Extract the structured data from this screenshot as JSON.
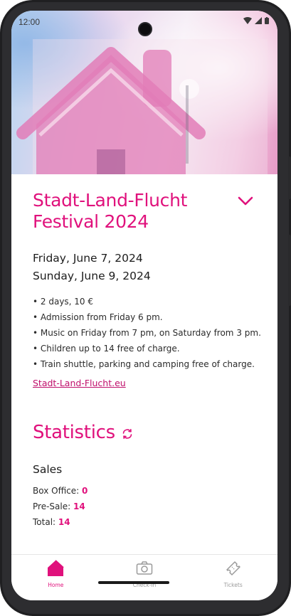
{
  "status_bar": {
    "time": "12:00"
  },
  "event": {
    "title": "Stadt-Land-Flucht Festival 2024",
    "date_start": "Friday, June 7, 2024",
    "date_end": "Sunday, June 9, 2024",
    "details": [
      "• 2 days, 10 €",
      "• Admission from Friday 6 pm.",
      "• Music on Friday from 7 pm, on Saturday from 3 pm.",
      "• Children up to 14 free of charge.",
      "• Train shuttle, parking and camping free of charge."
    ],
    "website": "Stadt-Land-Flucht.eu"
  },
  "statistics": {
    "title": "Statistics",
    "sales_title": "Sales",
    "rows": [
      {
        "label": "Box Office:",
        "value": "0"
      },
      {
        "label": "Pre-Sale:",
        "value": "14"
      },
      {
        "label": "Total:",
        "value": "14"
      }
    ]
  },
  "nav": [
    {
      "label": "Home",
      "icon": "home-icon",
      "active": true
    },
    {
      "label": "Check-in",
      "icon": "camera-icon",
      "active": false
    },
    {
      "label": "Tickets",
      "icon": "ticket-icon",
      "active": false
    }
  ],
  "colors": {
    "accent": "#e0117c",
    "inactive": "#9a9a9a"
  }
}
